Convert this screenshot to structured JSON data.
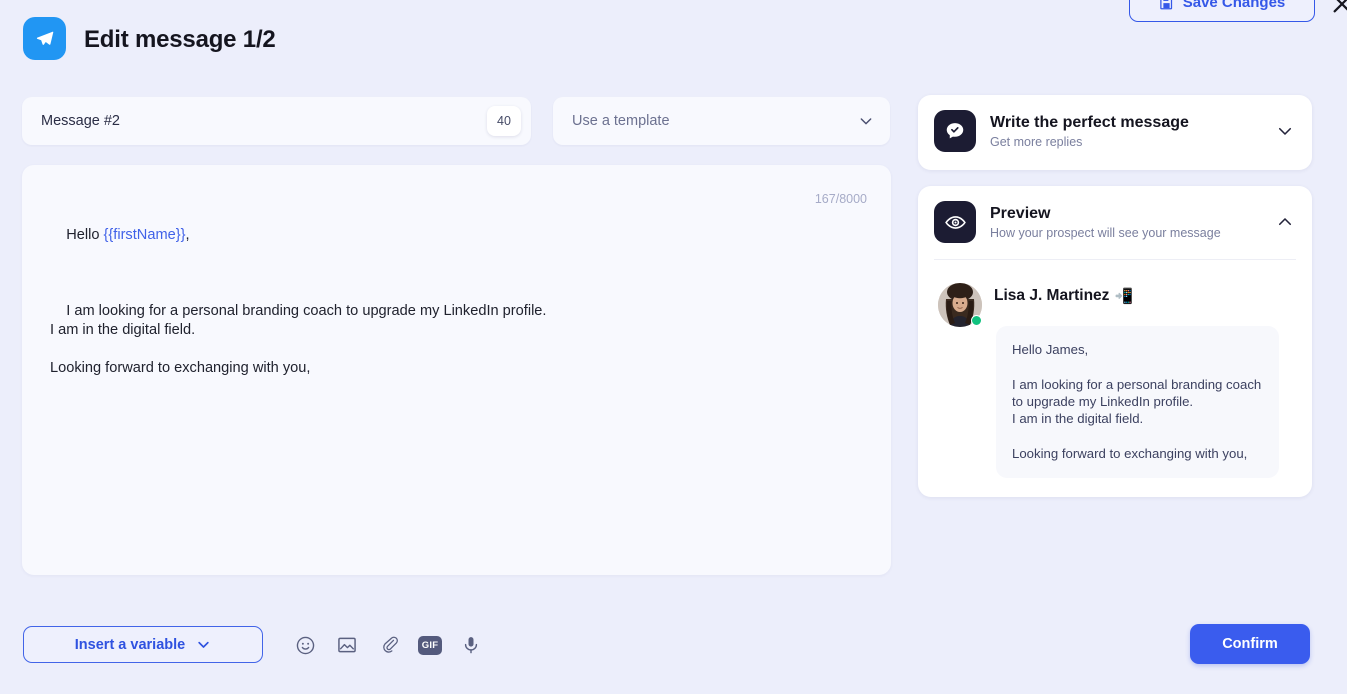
{
  "header": {
    "title": "Edit message 1/2",
    "logo_icon": "send-plane-icon",
    "save_label": "Save Changes",
    "save_icon": "floppy-disk-save-icon",
    "close_icon": "close-x-icon",
    "accent_blue": "#3558e8",
    "logo_blue": "#2196f3"
  },
  "message_meta": {
    "name_value": "Message #2",
    "delay_badge": "40",
    "template_placeholder": "Use a template",
    "template_chevron_icon": "chevron-down-icon"
  },
  "editor": {
    "char_counter": "167/8000",
    "greeting_prefix": "Hello ",
    "variable": "{{firstName}}",
    "greeting_suffix": ",",
    "body": "I am looking for a personal branding coach to upgrade my LinkedIn profile.\nI am in the digital field.\n\nLooking forward to exchanging with you,"
  },
  "bottom_bar": {
    "insert_variable_label": "Insert a variable",
    "insert_variable_chevron": "chevron-down-icon",
    "tools": [
      {
        "name": "emoji-icon",
        "label": "Emoji"
      },
      {
        "name": "image-icon",
        "label": "Image"
      },
      {
        "name": "attachment-paperclip-icon",
        "label": "Attachment"
      },
      {
        "name": "gif-icon",
        "label": "GIF"
      },
      {
        "name": "microphone-icon",
        "label": "Voice note"
      }
    ],
    "gif_label": "GIF",
    "confirm_label": "Confirm"
  },
  "side_panel": {
    "tips_card": {
      "icon": "chat-bubble-check-icon",
      "title": "Write the perfect message",
      "subtitle": "Get more replies",
      "chevron_icon": "chevron-down-icon",
      "expanded": false
    },
    "preview_card": {
      "icon": "eye-icon",
      "title": "Preview",
      "subtitle": "How your prospect will see your message",
      "chevron_icon": "chevron-up-icon",
      "expanded": true,
      "sender_name": "Lisa J. Martinez",
      "sender_emoji": "📲",
      "avatar_name": "sender-avatar",
      "status": "online",
      "message": "Hello James,\n\nI am looking for a personal branding coach to upgrade my LinkedIn profile.\nI am in the digital field.\n\nLooking forward to exchanging with you,"
    }
  }
}
